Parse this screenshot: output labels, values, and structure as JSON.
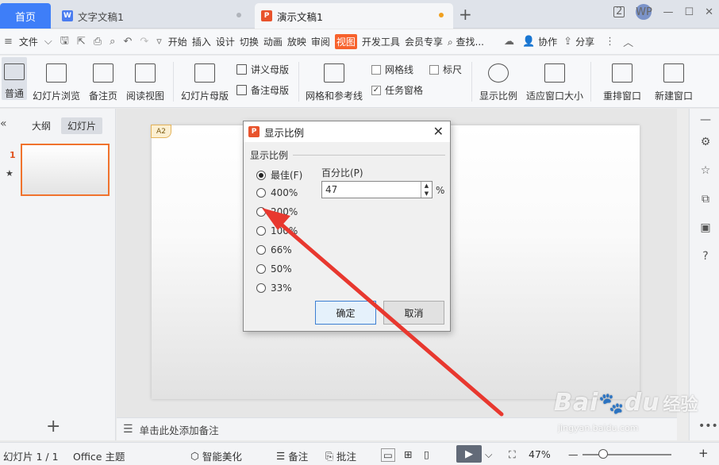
{
  "titlebar": {
    "home_tab": "首页",
    "tabs": [
      {
        "label": "文字文稿1",
        "icon": "W",
        "icon_color": "#4a7cf0",
        "dot_color": "#b0b4bb"
      },
      {
        "label": "演示文稿1",
        "icon": "P",
        "icon_color": "#e8532c",
        "dot_color": "#f0a01f"
      }
    ],
    "new_tab": "+",
    "window_count": "2",
    "avatar": "WP"
  },
  "menubar": {
    "file": "文件",
    "items": [
      "开始",
      "插入",
      "设计",
      "切换",
      "动画",
      "放映",
      "审阅",
      "视图",
      "开发工具",
      "会员专享"
    ],
    "active": "视图",
    "search": "查找...",
    "collaborate": "协作",
    "share": "分享"
  },
  "ribbon": {
    "normal": "普通",
    "slide_sorter": "幻灯片浏览",
    "notes_page": "备注页",
    "reading_view": "阅读视图",
    "slide_master": "幻灯片母版",
    "handout_master": "讲义母版",
    "notes_master": "备注母版",
    "grid_guides": "网格和参考线",
    "gridlines": "网格线",
    "ruler": "标尺",
    "task_pane": "任务窗格",
    "zoom": "显示比例",
    "fit_window": "适应窗口大小",
    "arrange": "重排窗口",
    "new_window": "新建窗口"
  },
  "leftpanel": {
    "outline_tab": "大纲",
    "slides_tab": "幻灯片",
    "slide_number": "1",
    "add": "+"
  },
  "slide": {
    "badge": "A2"
  },
  "notes": {
    "placeholder": "单击此处添加备注"
  },
  "statusbar": {
    "slide_info": "幻灯片 1 / 1",
    "theme": "Office 主题",
    "beautify": "智能美化",
    "notes": "备注",
    "comments": "批注",
    "zoom": "47%",
    "zoom_level": 0.47
  },
  "dialog": {
    "title": "显示比例",
    "group_label": "显示比例",
    "options": [
      "最佳(F)",
      "400%",
      "200%",
      "100%",
      "66%",
      "50%",
      "33%"
    ],
    "selected_index": 0,
    "percent_label": "百分比(P)",
    "percent_value": "47",
    "percent_sign": "%",
    "ok": "确定",
    "cancel": "取消"
  },
  "watermark": {
    "brand": "Bai",
    "paw": "du",
    "sub": "经验",
    "url": "jingyan.baidu.com"
  },
  "colors": {
    "accent": "#3e7ef8",
    "active_menu": "#f7622d",
    "arrow": "#e8382f"
  }
}
